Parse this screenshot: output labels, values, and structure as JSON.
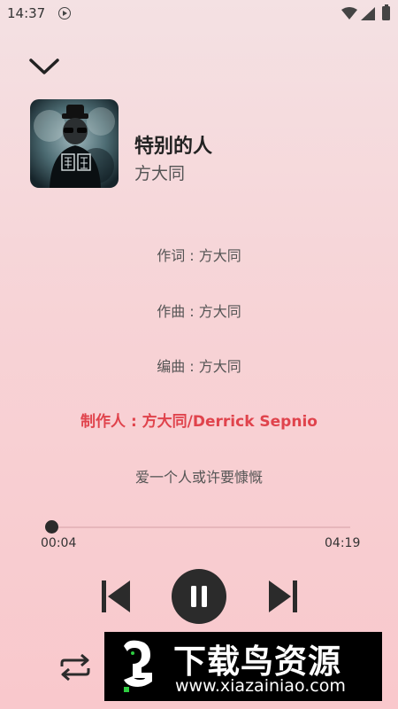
{
  "status_bar": {
    "time": "14:37",
    "icons": [
      "media-playing-icon",
      "wifi-icon",
      "signal-icon",
      "battery-icon"
    ]
  },
  "player": {
    "collapse_icon": "chevron-down-icon",
    "song": {
      "title": "特别的人",
      "artist": "方大同"
    },
    "lyrics": [
      {
        "text": "作词 : 方大同",
        "active": false
      },
      {
        "text": "作曲 : 方大同",
        "active": false
      },
      {
        "text": "编曲 : 方大同",
        "active": false
      },
      {
        "text": "制作人 : 方大同/Derrick Sepnio",
        "active": true
      },
      {
        "text": "爱一个人或许要慷慨",
        "active": false
      }
    ],
    "progress": {
      "current": "00:04",
      "total": "04:19",
      "fraction": 0.015
    },
    "controls": [
      "previous-icon",
      "pause-icon",
      "next-icon",
      "repeat-icon"
    ]
  },
  "watermark": {
    "name": "下载鸟资源",
    "url": "www.xiazainiao.com"
  },
  "colors": {
    "accent": "#e0434c",
    "control": "#2b2b2b",
    "background": "#f7d3d6"
  }
}
